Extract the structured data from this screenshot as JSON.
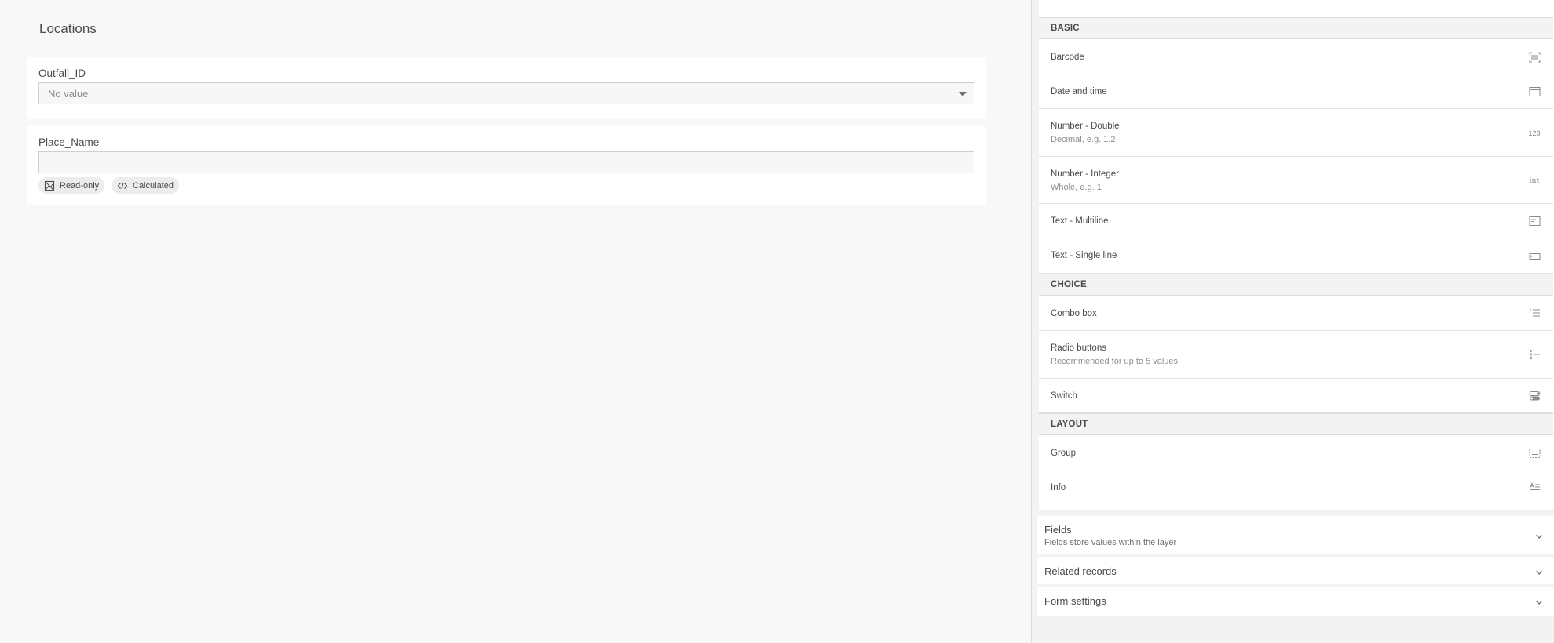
{
  "form": {
    "title": "Locations",
    "fields": [
      {
        "label": "Outfall_ID",
        "placeholder": "No value"
      },
      {
        "label": "Place_Name",
        "chips": [
          "Read-only",
          "Calculated"
        ]
      }
    ]
  },
  "palette": {
    "sections": [
      {
        "header": "BASIC",
        "items": [
          {
            "title": "Barcode",
            "icon": "barcode-icon"
          },
          {
            "title": "Date and time",
            "icon": "calendar-icon"
          },
          {
            "title": "Number - Double",
            "subtitle": "Decimal, e.g. 1.2",
            "icon": "number-123-icon",
            "icon_text": "123"
          },
          {
            "title": "Number - Integer",
            "subtitle": "Whole, e.g. 1",
            "icon": "integer-icon",
            "icon_text": "int"
          },
          {
            "title": "Text - Multiline",
            "icon": "text-multiline-icon"
          },
          {
            "title": "Text - Single line",
            "icon": "text-single-line-icon"
          }
        ]
      },
      {
        "header": "CHOICE",
        "items": [
          {
            "title": "Combo box",
            "icon": "combo-box-icon"
          },
          {
            "title": "Radio buttons",
            "subtitle": "Recommended for up to 5 values",
            "icon": "radio-list-icon"
          },
          {
            "title": "Switch",
            "icon": "switch-icon"
          }
        ]
      },
      {
        "header": "LAYOUT",
        "items": [
          {
            "title": "Group",
            "icon": "group-icon"
          },
          {
            "title": "Info",
            "icon": "info-text-icon"
          }
        ]
      }
    ]
  },
  "accordions": [
    {
      "title": "Fields",
      "subtitle": "Fields store values within the layer"
    },
    {
      "title": "Related records"
    },
    {
      "title": "Form settings"
    }
  ]
}
